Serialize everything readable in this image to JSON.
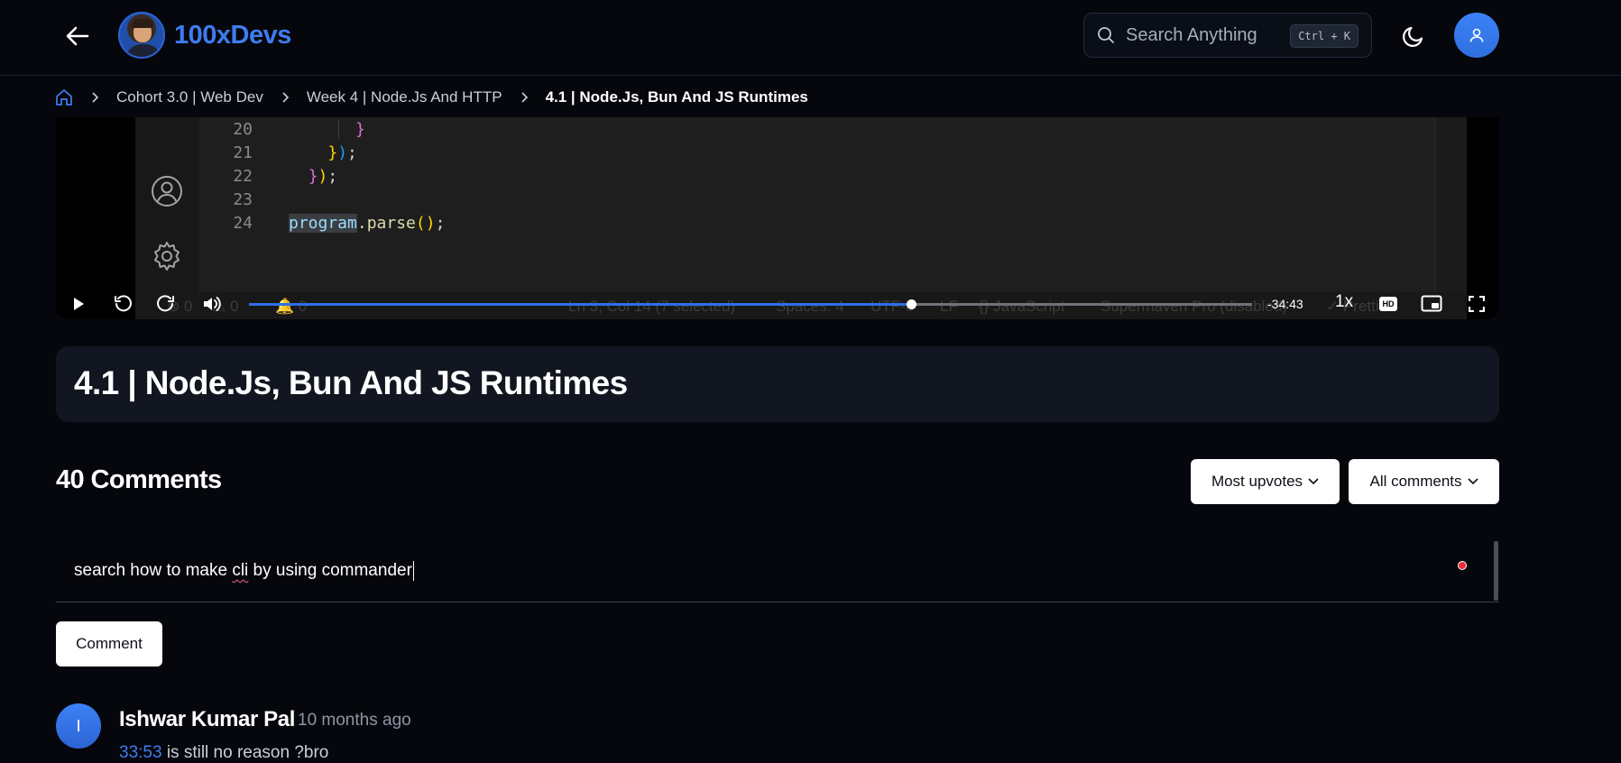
{
  "header": {
    "brand_name": "100xDevs",
    "search_placeholder": "Search Anything",
    "search_shortcut": "Ctrl + K"
  },
  "breadcrumb": {
    "items": [
      "Cohort 3.0 | Web Dev",
      "Week 4 | Node.Js And HTTP"
    ],
    "current": "4.1 | Node.Js, Bun And JS Runtimes"
  },
  "video": {
    "code_lines": [
      {
        "number": "20",
        "text": "}"
      },
      {
        "number": "21",
        "text": "});"
      },
      {
        "number": "22",
        "text": "});"
      },
      {
        "number": "23",
        "text": ""
      },
      {
        "number": "24",
        "text": "program.parse();"
      }
    ],
    "status_bar_ghost": [
      "⊗ 0",
      "⚠ 0",
      "🔔 0",
      "Ln 3, Col 14 (7 selected)",
      "Spaces: 4",
      "UTF-8",
      "LF",
      "{} JavaScript",
      "Supermaven Pro (disabled)",
      "✓ Prettier"
    ],
    "progress_fraction": 0.66,
    "time_remaining": "-34:43",
    "playback_speed": "1x",
    "quality_badge": "HD"
  },
  "lesson": {
    "title": "4.1 | Node.Js, Bun And JS Runtimes"
  },
  "comments": {
    "count_label": "40 Comments",
    "sort_label": "Most upvotes",
    "filter_label": "All comments",
    "input_value": "search how to make cli by using commander",
    "input_misspelled_word": "cli",
    "submit_label": "Comment",
    "items": [
      {
        "avatar_initial": "I",
        "author": "Ishwar Kumar Pal",
        "time": "10 months ago",
        "timestamp_link": "33:53",
        "body": "is still no reason ?bro"
      }
    ]
  },
  "colors": {
    "accent": "#3f7cf0",
    "background": "#05070d",
    "card": "#121620"
  }
}
